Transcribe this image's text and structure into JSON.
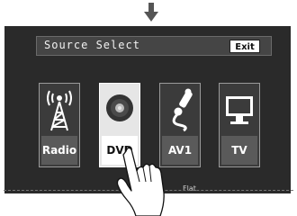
{
  "header": {
    "title": "Source Select",
    "exit_label": "Exit"
  },
  "sources": [
    {
      "label": "Radio",
      "icon": "antenna-icon"
    },
    {
      "label": "DVD",
      "icon": "disc-icon",
      "selected": true
    },
    {
      "label": "AV1",
      "icon": "plug-icon"
    },
    {
      "label": "TV",
      "icon": "monitor-icon"
    }
  ],
  "footer": {
    "text": "Flat"
  },
  "colors": {
    "screen_bg": "#2a2a2a",
    "tile_bg": "#3b3b3b",
    "selected_tile_bg": "#e6e6e6"
  }
}
